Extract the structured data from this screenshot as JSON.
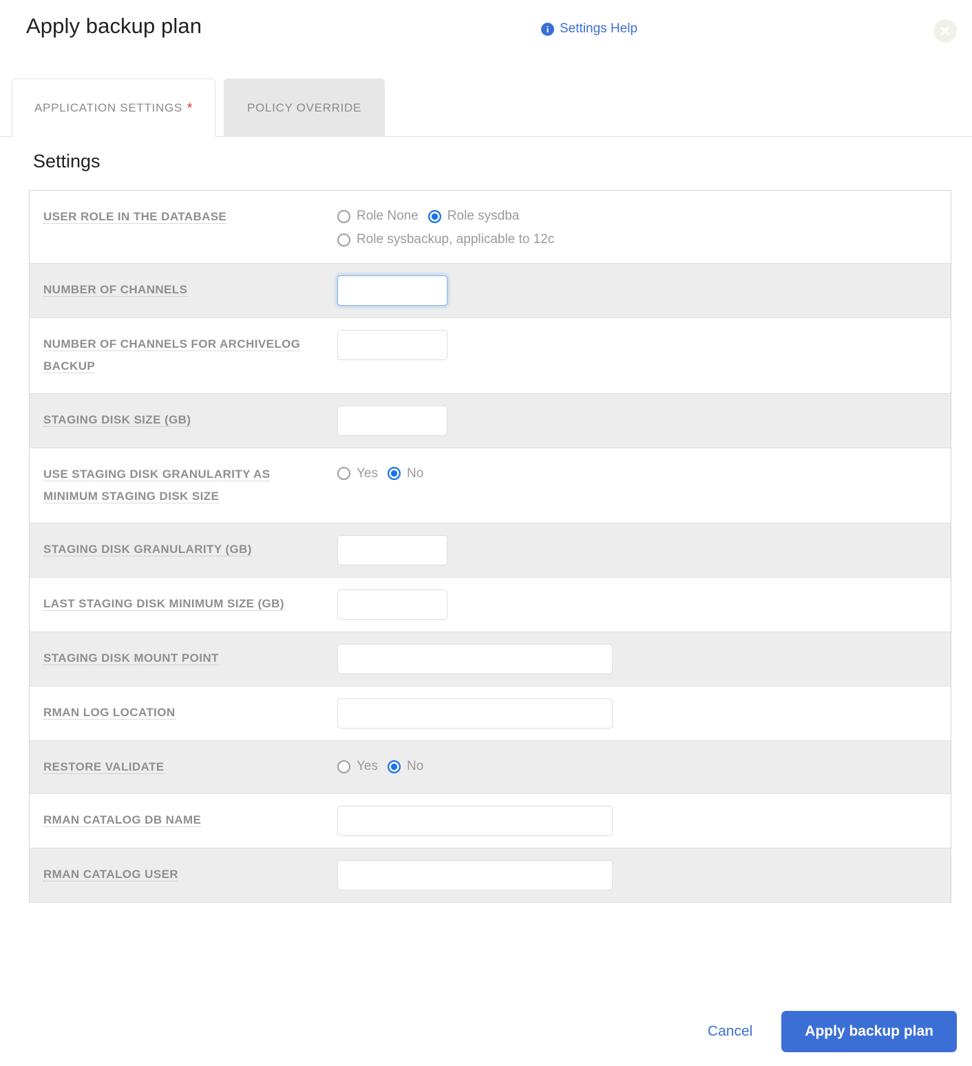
{
  "header": {
    "title": "Apply backup plan",
    "help_label": "Settings Help",
    "info_icon": "info-icon",
    "close_icon": "close-icon"
  },
  "tabs": [
    {
      "label": "APPLICATION SETTINGS",
      "required_marker": "*",
      "active": true
    },
    {
      "label": "POLICY OVERRIDE",
      "required_marker": "",
      "active": false
    }
  ],
  "section": {
    "title": "Settings"
  },
  "rows": [
    {
      "label": "USER ROLE IN THE DATABASE",
      "type": "radio",
      "alt": false,
      "options": [
        {
          "label": "Role None",
          "selected": false,
          "break_after": false
        },
        {
          "label": "Role sysdba",
          "selected": true,
          "break_after": true
        },
        {
          "label": "Role sysbackup, applicable to 12c",
          "selected": false,
          "break_after": false
        }
      ]
    },
    {
      "label": "NUMBER OF CHANNELS",
      "type": "text",
      "alt": true,
      "value": "",
      "size": "sm",
      "focused": true
    },
    {
      "label": "NUMBER OF CHANNELS FOR ARCHIVELOG BACKUP",
      "type": "text",
      "alt": false,
      "value": "",
      "size": "sm",
      "focused": false
    },
    {
      "label": "STAGING DISK SIZE (GB)",
      "type": "text",
      "alt": true,
      "value": "",
      "size": "sm",
      "focused": false
    },
    {
      "label": "USE STAGING DISK GRANULARITY AS MINIMUM STAGING DISK SIZE",
      "type": "radio",
      "alt": false,
      "options": [
        {
          "label": "Yes",
          "selected": false,
          "break_after": false
        },
        {
          "label": "No",
          "selected": true,
          "break_after": false
        }
      ]
    },
    {
      "label": "STAGING DISK GRANULARITY (GB)",
      "type": "text",
      "alt": true,
      "value": "",
      "size": "sm",
      "focused": false
    },
    {
      "label": "LAST STAGING DISK MINIMUM SIZE (GB)",
      "type": "text",
      "alt": false,
      "value": "",
      "size": "sm",
      "focused": false
    },
    {
      "label": "STAGING DISK MOUNT POINT",
      "type": "text",
      "alt": true,
      "value": "",
      "size": "lg",
      "focused": false
    },
    {
      "label": "RMAN LOG LOCATION",
      "type": "text",
      "alt": false,
      "value": "",
      "size": "lg",
      "focused": false
    },
    {
      "label": "RESTORE VALIDATE",
      "type": "radio",
      "alt": true,
      "options": [
        {
          "label": "Yes",
          "selected": false,
          "break_after": false
        },
        {
          "label": "No",
          "selected": true,
          "break_after": false
        }
      ]
    },
    {
      "label": "RMAN CATALOG DB NAME",
      "type": "text",
      "alt": false,
      "value": "",
      "size": "lg",
      "focused": false
    },
    {
      "label": "RMAN CATALOG USER",
      "type": "text",
      "alt": true,
      "value": "",
      "size": "lg",
      "focused": false
    }
  ],
  "footer": {
    "cancel_label": "Cancel",
    "apply_label": "Apply backup plan"
  },
  "colors": {
    "accent_blue": "#3c6fd6",
    "radio_selected": "#1a73e8",
    "required_red": "#d93025",
    "label_gray": "#8f8f8f",
    "alt_row": "#ededed"
  }
}
